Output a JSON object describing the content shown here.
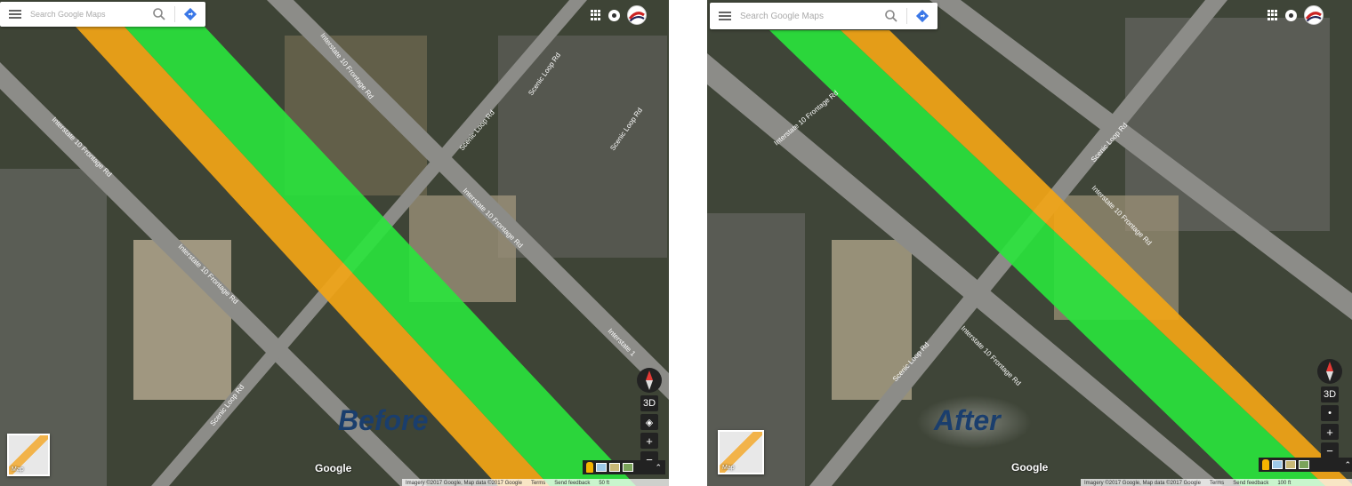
{
  "search": {
    "placeholder": "Search Google Maps"
  },
  "before": {
    "overlay_label": "Before",
    "road_labels": {
      "frontage_upper": "Interstate 10 Frontage Rd",
      "frontage_mid": "Interstate 10 Frontage Rd",
      "frontage_left": "Interstate 10 Frontage Rd",
      "frontage_lower": "Interstate 10 Frontage Rd",
      "frontage_right": "Interstate 1",
      "scenic_upper": "Scenic Loop Rd",
      "scenic_mid": "Scenic Loop Rd",
      "scenic_lower": "Scenic Loop Rd",
      "scenic_right": "Scenic Loop Rd"
    },
    "footer": {
      "imagery": "Imagery ©2017 Google, Map data ©2017 Google",
      "terms": "Terms",
      "feedback": "Send feedback",
      "scale": "50 ft"
    }
  },
  "after": {
    "overlay_label": "After",
    "road_labels": {
      "frontage_left": "Interstate 10 Frontage Rd",
      "frontage_right": "Interstate 10 Frontage Rd",
      "frontage_lower": "Interstate 10 Frontage Rd",
      "scenic_upper": "Scenic Loop Rd",
      "scenic_lower": "Scenic Loop Rd"
    },
    "footer": {
      "imagery": "Imagery ©2017 Google, Map data ©2017 Google",
      "terms": "Terms",
      "feedback": "Send feedback",
      "scale": "100 ft"
    }
  },
  "brand": "Google",
  "minimap_label": "Map",
  "controls": {
    "three_d": "3D",
    "zoom_in": "+",
    "zoom_out": "−",
    "locate": "◈",
    "dot": "•",
    "chevron": "⌃"
  },
  "colors": {
    "orange_lane": "#f2a516",
    "green_lane": "#29e63c",
    "terrain": "#3f4538",
    "road": "#8a8a88",
    "overlay_text": "#1a3e6d"
  }
}
